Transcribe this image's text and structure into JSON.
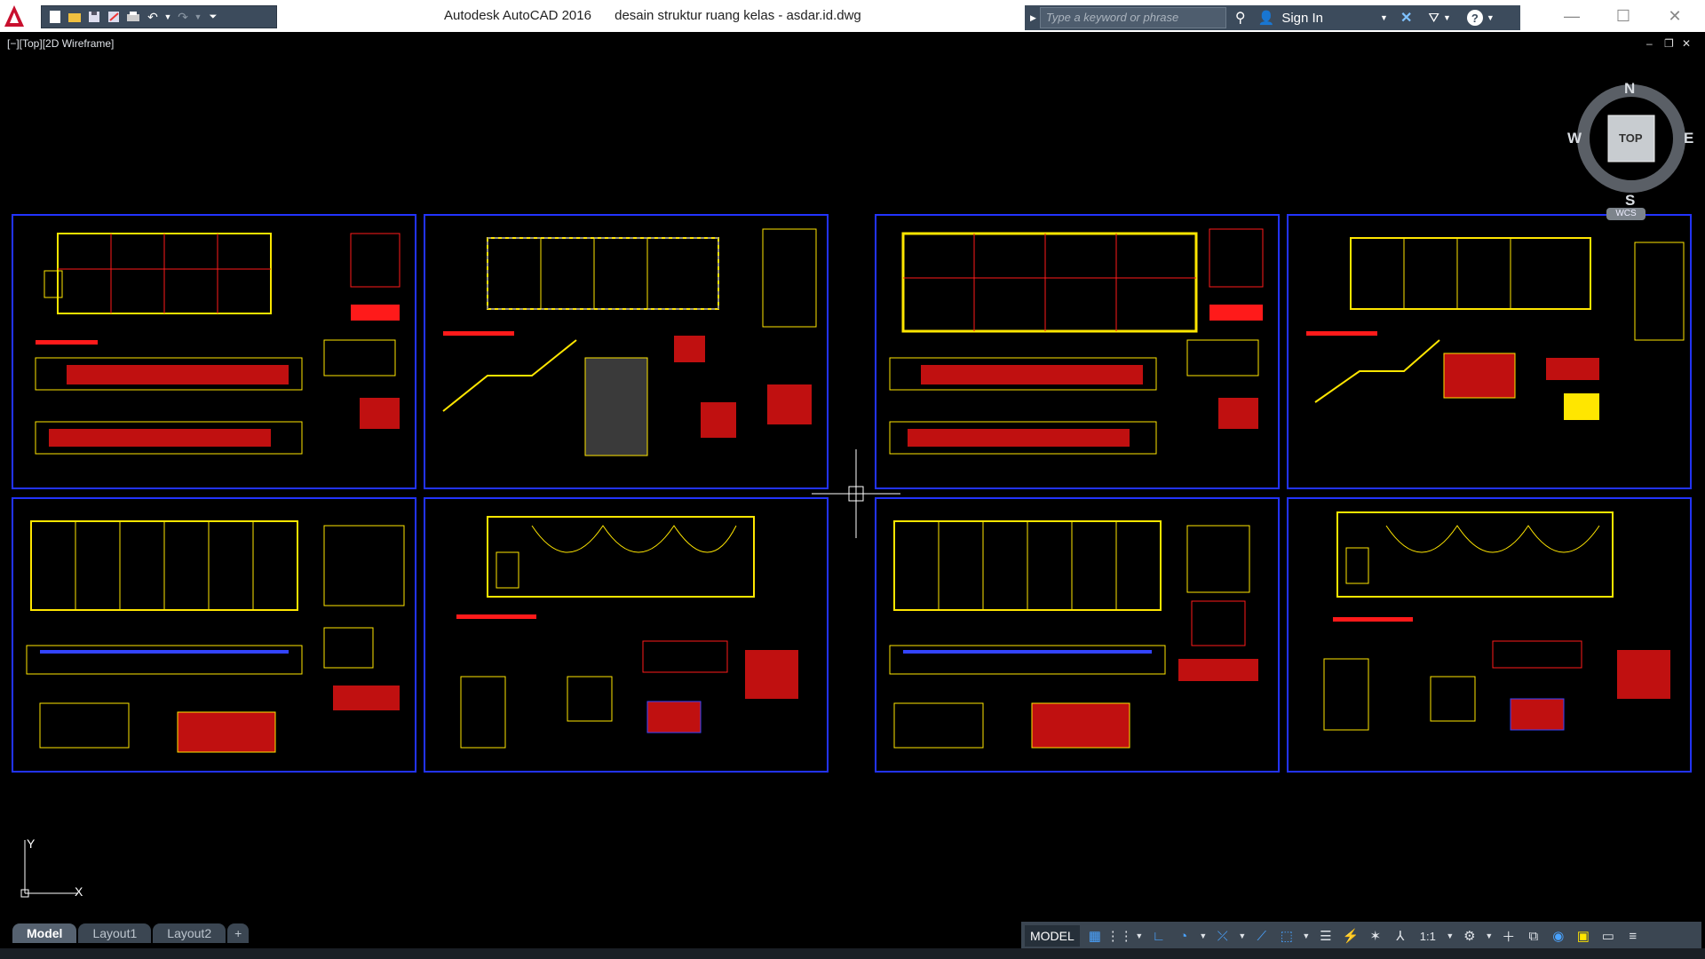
{
  "window": {
    "app_name": "Autodesk AutoCAD 2016",
    "file_name": "desain struktur ruang kelas - asdar.id.dwg",
    "minimize": "—",
    "maximize": "☐",
    "close": "✕"
  },
  "infocenter": {
    "search_placeholder": "Type a keyword or phrase",
    "sign_in": "Sign In"
  },
  "viewport": {
    "label": "[−][Top][2D Wireframe]",
    "ctl_min": "–",
    "ctl_restore": "❐",
    "ctl_close": "✕"
  },
  "viewcube": {
    "north": "N",
    "south": "S",
    "east": "E",
    "west": "W",
    "face": "TOP",
    "wcs": "WCS"
  },
  "ucs": {
    "x": "X",
    "y": "Y"
  },
  "tabs": [
    {
      "label": "Model",
      "active": true
    },
    {
      "label": "Layout1",
      "active": false
    },
    {
      "label": "Layout2",
      "active": false
    },
    {
      "label": "+",
      "active": false
    }
  ],
  "status": {
    "model": "MODEL",
    "scale": "1:1"
  },
  "colors": {
    "sheet_border": "#2233ff",
    "accent_red": "#ff1a1a",
    "accent_yellow": "#ffe600",
    "accent_blue": "#3344ff"
  }
}
